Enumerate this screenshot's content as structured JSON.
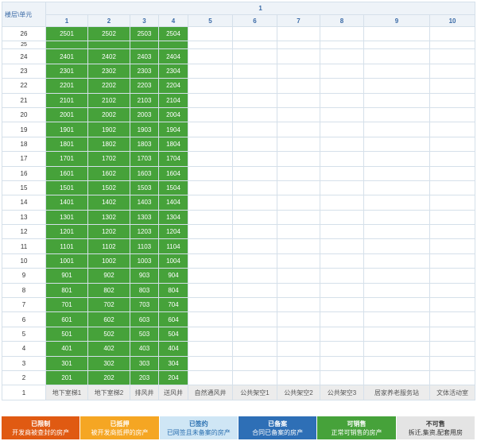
{
  "header": {
    "corner_label": "楼层\\单元",
    "building": "1",
    "unit_columns": [
      "1",
      "2",
      "3",
      "4",
      "5",
      "6",
      "7",
      "8",
      "9",
      "10"
    ]
  },
  "rows": [
    {
      "floor": "26",
      "units": [
        "2501",
        "2502",
        "2503",
        "2504"
      ]
    },
    {
      "floor": "25",
      "units": []
    },
    {
      "floor": "24",
      "units": [
        "2401",
        "2402",
        "2403",
        "2404"
      ]
    },
    {
      "floor": "23",
      "units": [
        "2301",
        "2302",
        "2303",
        "2304"
      ]
    },
    {
      "floor": "22",
      "units": [
        "2201",
        "2202",
        "2203",
        "2204"
      ]
    },
    {
      "floor": "21",
      "units": [
        "2101",
        "2102",
        "2103",
        "2104"
      ]
    },
    {
      "floor": "20",
      "units": [
        "2001",
        "2002",
        "2003",
        "2004"
      ]
    },
    {
      "floor": "19",
      "units": [
        "1901",
        "1902",
        "1903",
        "1904"
      ]
    },
    {
      "floor": "18",
      "units": [
        "1801",
        "1802",
        "1803",
        "1804"
      ]
    },
    {
      "floor": "17",
      "units": [
        "1701",
        "1702",
        "1703",
        "1704"
      ]
    },
    {
      "floor": "16",
      "units": [
        "1601",
        "1602",
        "1603",
        "1604"
      ]
    },
    {
      "floor": "15",
      "units": [
        "1501",
        "1502",
        "1503",
        "1504"
      ]
    },
    {
      "floor": "14",
      "units": [
        "1401",
        "1402",
        "1403",
        "1404"
      ]
    },
    {
      "floor": "13",
      "units": [
        "1301",
        "1302",
        "1303",
        "1304"
      ]
    },
    {
      "floor": "12",
      "units": [
        "1201",
        "1202",
        "1203",
        "1204"
      ]
    },
    {
      "floor": "11",
      "units": [
        "1101",
        "1102",
        "1103",
        "1104"
      ]
    },
    {
      "floor": "10",
      "units": [
        "1001",
        "1002",
        "1003",
        "1004"
      ]
    },
    {
      "floor": "9",
      "units": [
        "901",
        "902",
        "903",
        "904"
      ]
    },
    {
      "floor": "8",
      "units": [
        "801",
        "802",
        "803",
        "804"
      ]
    },
    {
      "floor": "7",
      "units": [
        "701",
        "702",
        "703",
        "704"
      ]
    },
    {
      "floor": "6",
      "units": [
        "601",
        "602",
        "603",
        "604"
      ]
    },
    {
      "floor": "5",
      "units": [
        "501",
        "502",
        "503",
        "504"
      ]
    },
    {
      "floor": "4",
      "units": [
        "401",
        "402",
        "403",
        "404"
      ]
    },
    {
      "floor": "3",
      "units": [
        "301",
        "302",
        "303",
        "304"
      ]
    },
    {
      "floor": "2",
      "units": [
        "201",
        "202",
        "203",
        "204"
      ]
    }
  ],
  "footer": {
    "floor": "1",
    "cells": [
      "地下室梯1",
      "地下室梯2",
      "排风井",
      "送风井",
      "自然通风井",
      "公共架空1",
      "公共架空2",
      "公共架空3",
      "居家养老服务站",
      "文体活动室"
    ]
  },
  "legend": [
    {
      "title": "已限制",
      "desc": "开发商被查封的房产",
      "bg": "#e05a12",
      "fg": "#ffffff"
    },
    {
      "title": "已抵押",
      "desc": "被开发商抵押的房产",
      "bg": "#f5a623",
      "fg": "#ffffff"
    },
    {
      "title": "已签约",
      "desc": "已网签且未备案的房产",
      "bg": "#cfe6f5",
      "fg": "#2a6fb0"
    },
    {
      "title": "已备案",
      "desc": "合同已备案的房产",
      "bg": "#2e6fb6",
      "fg": "#ffffff"
    },
    {
      "title": "可销售",
      "desc": "正常可销售的房产",
      "bg": "#46a23a",
      "fg": "#ffffff"
    },
    {
      "title": "不可售",
      "desc": "拆迁,集资,配套用房",
      "bg": "#e4e4e4",
      "fg": "#333333"
    }
  ]
}
